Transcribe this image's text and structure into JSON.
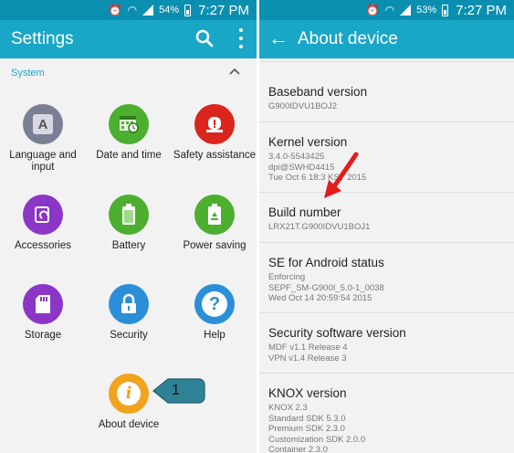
{
  "status_bar_left": {
    "battery": "54%",
    "time": "7:27 PM"
  },
  "status_bar_right": {
    "battery": "53%",
    "time": "7:27 PM"
  },
  "settings": {
    "title": "Settings",
    "section": "System",
    "tiles": [
      {
        "label": "Language and input",
        "icon": "language-icon",
        "color": "#7a7f94"
      },
      {
        "label": "Date and time",
        "icon": "calendar-clock-icon",
        "color": "#4caf2f"
      },
      {
        "label": "Safety assistance",
        "icon": "alert-icon",
        "color": "#d9251c"
      },
      {
        "label": "Accessories",
        "icon": "accessories-icon",
        "color": "#8b36c7"
      },
      {
        "label": "Battery",
        "icon": "battery-icon",
        "color": "#4caf2f"
      },
      {
        "label": "Power saving",
        "icon": "recycle-icon",
        "color": "#4caf2f"
      },
      {
        "label": "Storage",
        "icon": "sd-card-icon",
        "color": "#8b36c7"
      },
      {
        "label": "Security",
        "icon": "lock-icon",
        "color": "#2a8fd8"
      },
      {
        "label": "Help",
        "icon": "help-icon",
        "color": "#2a8fd8"
      },
      {
        "label": "About device",
        "icon": "info-icon",
        "color": "#f0a31c"
      }
    ],
    "callout_number": "1"
  },
  "about": {
    "title": "About device",
    "items": [
      {
        "title": "Baseband version",
        "lines": [
          "G900IDVU1BOJ2"
        ]
      },
      {
        "title": "Kernel version",
        "lines": [
          "3.4.0-5543425",
          "dpi@SWHD4415",
          "Tue Oct 6 18:3 KST 2015"
        ]
      },
      {
        "title": "Build number",
        "lines": [
          "LRX21T.G900IDVU1BOJ1"
        ]
      },
      {
        "title": "SE for Android status",
        "lines": [
          "Enforcing",
          "SEPF_SM-G900I_5.0-1_0038",
          "Wed Oct 14 20:59:54 2015"
        ]
      },
      {
        "title": "Security software version",
        "lines": [
          "MDF v1.1 Release 4",
          "VPN v1.4 Release 3"
        ]
      },
      {
        "title": "KNOX version",
        "lines": [
          "KNOX 2.3",
          "Standard SDK 5.3.0",
          "Premium SDK 2.3.0",
          "Customization SDK 2.0.0",
          "Container 2.3.0"
        ]
      }
    ]
  }
}
